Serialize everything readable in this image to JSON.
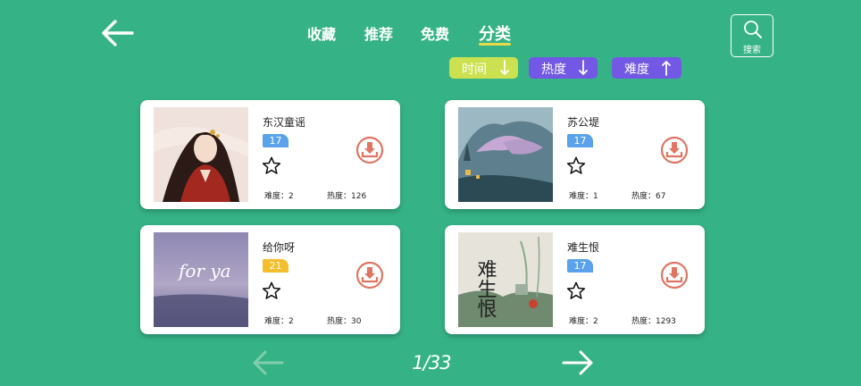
{
  "nav": {
    "tabs": [
      {
        "label": "收藏"
      },
      {
        "label": "推荐"
      },
      {
        "label": "免费"
      },
      {
        "label": "分类",
        "active": true
      }
    ],
    "search_label": "搜索",
    "back_icon": "arrow-left-icon"
  },
  "sort": [
    {
      "label": "时间",
      "direction": "down",
      "color": "#cbe14f"
    },
    {
      "label": "热度",
      "direction": "down",
      "color": "#7357e5"
    },
    {
      "label": "难度",
      "direction": "up",
      "color": "#7357e5"
    }
  ],
  "songs": [
    {
      "title": "东汉童谣",
      "level": "17",
      "badge_color": "#5aa2ec",
      "difficulty": "难度：2",
      "popularity": "热度：126"
    },
    {
      "title": "苏公堤",
      "level": "17",
      "badge_color": "#5aa2ec",
      "difficulty": "难度：1",
      "popularity": "热度：67"
    },
    {
      "title": "给你呀",
      "level": "21",
      "badge_color": "#f5be2c",
      "difficulty": "难度：2",
      "popularity": "热度：30"
    },
    {
      "title": "难生恨",
      "level": "17",
      "badge_color": "#5aa2ec",
      "difficulty": "难度：2",
      "popularity": "热度：1293"
    }
  ],
  "covers": {
    "cover2_text": "for ya",
    "cover3_text": "难生恨"
  },
  "pager": {
    "page": "1/33"
  },
  "colors": {
    "background": "#35b386",
    "tab_underline": "#e8d94a",
    "download": "#e07563"
  }
}
